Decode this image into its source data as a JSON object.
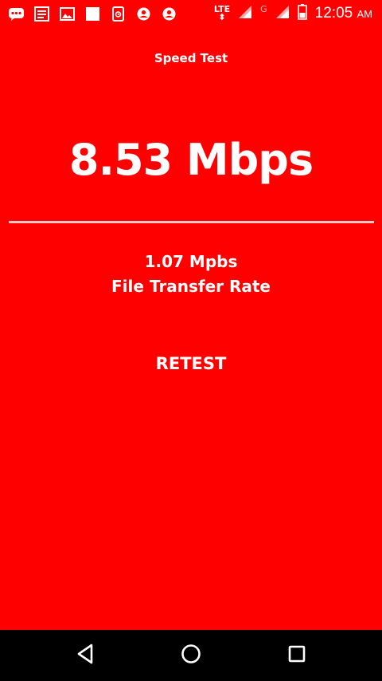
{
  "status_bar": {
    "notification_icons": [
      "chat-bubble-icon",
      "news-icon",
      "image-icon",
      "stop-square-icon",
      "screenshot-icon",
      "account-icon",
      "account-icon"
    ],
    "network_label": "LTE",
    "secondary_network_label": "G",
    "clock_time": "12:05",
    "clock_ampm": "AM"
  },
  "app": {
    "title": "Speed Test",
    "speed_value": "8.53 Mbps",
    "transfer_rate_value": "1.07 Mpbs",
    "transfer_rate_label": "File Transfer Rate",
    "retest_label": "RETEST"
  },
  "nav_bar": {
    "icons": [
      "back-icon",
      "home-icon",
      "recents-icon"
    ]
  },
  "colors": {
    "background": "#ff0000",
    "text": "#ffffff",
    "divider": "#f3c7c7",
    "nav_bar": "#000000"
  }
}
